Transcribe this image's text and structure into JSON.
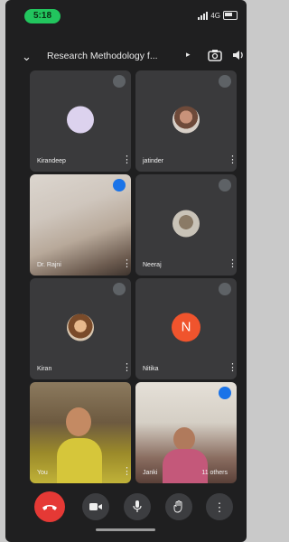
{
  "status_bar": {
    "time": "5:18",
    "network": "4G"
  },
  "header": {
    "meeting_title": "Research Methodology f..."
  },
  "participants": [
    {
      "name": "Kirandeep",
      "state": "muted"
    },
    {
      "name": "jatinder",
      "state": "muted"
    },
    {
      "name": "Dr. Rajni",
      "state": "speaking"
    },
    {
      "name": "Neeraj",
      "state": "muted"
    },
    {
      "name": "Kiran",
      "state": "muted"
    },
    {
      "name": "Nitika",
      "state": "muted",
      "avatar_letter": "N"
    },
    {
      "name": "You",
      "state": "video"
    },
    {
      "name": "Janki",
      "state": "speaking",
      "extra": "11 others"
    }
  ],
  "colors": {
    "background": "#1f1f20",
    "tile": "#3a3a3c",
    "end_call": "#e53935",
    "speaking_badge": "#1a73e8",
    "letter_avatar": "#f0542d",
    "time_pill": "#22c55e"
  },
  "controls": [
    "end-call",
    "camera",
    "microphone",
    "raise-hand",
    "more-options"
  ]
}
